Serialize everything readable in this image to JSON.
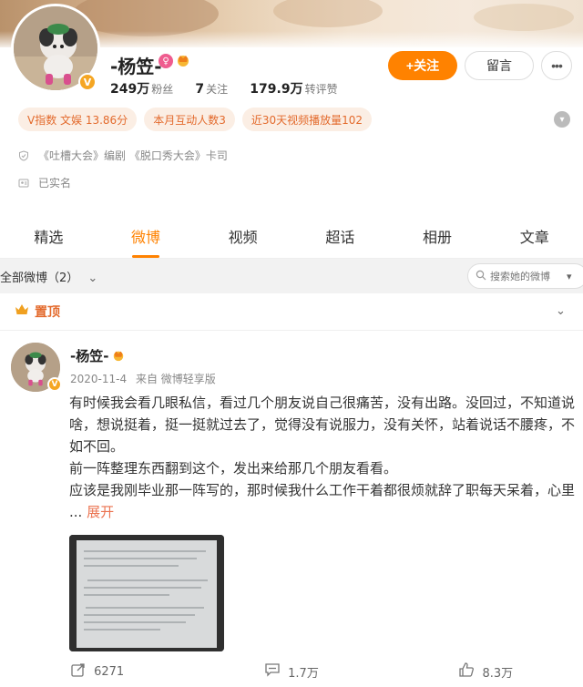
{
  "profile": {
    "name": "-杨笠-",
    "stats": [
      {
        "num": "249万",
        "label": "粉丝"
      },
      {
        "num": "7",
        "label": "关注"
      },
      {
        "num": "179.9万",
        "label": "转评赞"
      }
    ],
    "follow_label": "+关注",
    "message_label": "留言",
    "more_label": "•••",
    "tags": [
      "V指数 文娱 13.86分",
      "本月互动人数3",
      "近30天视频播放量102"
    ],
    "info": {
      "title_line": "《吐槽大会》编剧 《脱口秀大会》卡司",
      "verified_line": "已实名"
    }
  },
  "tabs": [
    "精选",
    "微博",
    "视频",
    "超话",
    "相册",
    "文章"
  ],
  "active_tab": "微博",
  "filter": {
    "label": "全部微博（2）",
    "search_placeholder": "搜索她的微博"
  },
  "post": {
    "pinned_label": "置顶",
    "author": "-杨笠-",
    "date": "2020-11-4",
    "source": "来自 微博轻享版",
    "paragraphs": [
      "有时候我会看几眼私信，看过几个朋友说自己很痛苦，没有出路。没回过，不知道说啥，想说挺着，挺一挺就过去了，觉得没有说服力，没有关怀，站着说话不腰疼，不如不回。",
      "前一阵整理东西翻到这个，发出来给那几个朋友看看。",
      "应该是我刚毕业那一阵写的，那时候我什么工作干着都很烦就辞了职每天呆着，心里 ..."
    ],
    "expand_label": "展开",
    "reposts": "6271",
    "comments": "1.7万",
    "likes": "8.3万"
  },
  "colors": {
    "accent": "#ff8200",
    "tag_bg": "#fbeee4",
    "tag_text": "#e36a2c",
    "link": "#eb7350"
  }
}
